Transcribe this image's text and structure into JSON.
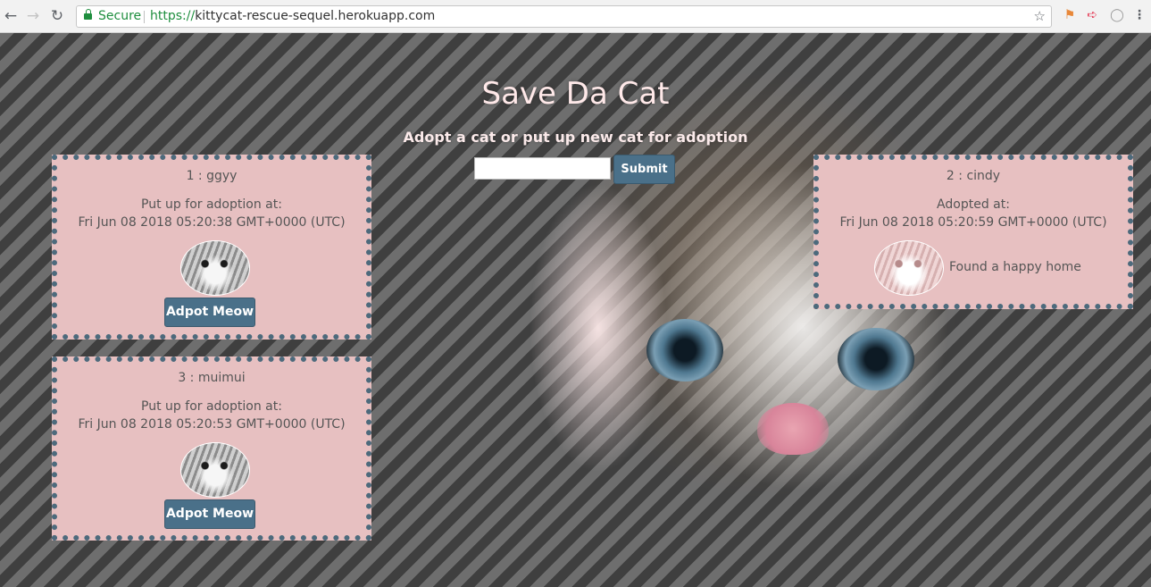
{
  "browser": {
    "secure_label": "Secure",
    "url_scheme": "https://",
    "url_rest": "kittycat-rescue-sequel.herokuapp.com"
  },
  "header": {
    "title": "Save Da Cat",
    "subtitle": "Adopt a cat or put up new cat for adoption"
  },
  "form": {
    "input_value": "",
    "submit_label": "Submit"
  },
  "cards": [
    {
      "name": "1 : ggyy",
      "line1": "Put up for adoption at:",
      "line2": "Fri Jun 08 2018 05:20:38 GMT+0000 (UTC)",
      "button_label": "Adpot Meow"
    },
    {
      "name": "3 : muimui",
      "line1": "Put up for adoption at:",
      "line2": "Fri Jun 08 2018 05:20:53 GMT+0000 (UTC)",
      "button_label": "Adpot Meow"
    },
    {
      "name": "2 : cindy",
      "line1": "Adopted at:",
      "line2": "Fri Jun 08 2018 05:20:59 GMT+0000 (UTC)",
      "status": "Found a happy home"
    }
  ],
  "colors": {
    "card_bg": "#e7c0c1",
    "card_border": "#4d6a7c",
    "button_bg": "#4a7089"
  }
}
